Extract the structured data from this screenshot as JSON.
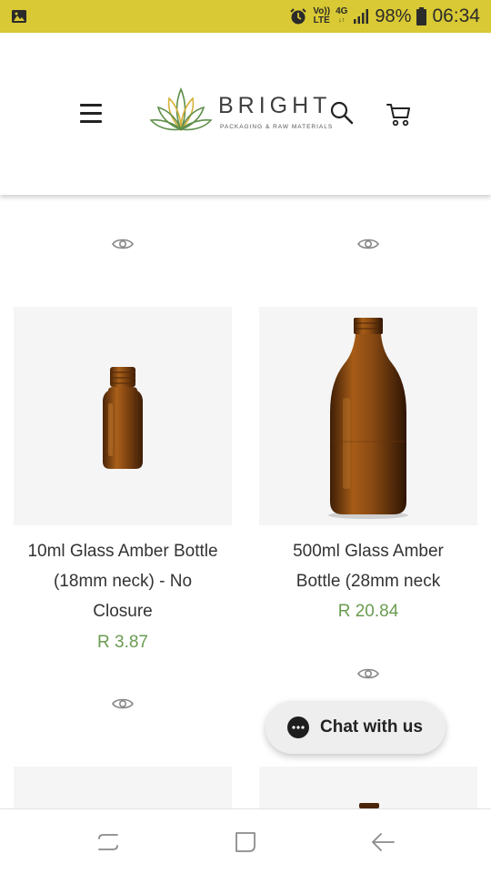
{
  "status_bar": {
    "volte_top": "Vo))",
    "volte_bottom": "LTE",
    "network_top": "4G",
    "network_bottom": "↓↑",
    "battery": "98%",
    "time": "06:34",
    "icons": [
      "gallery-icon",
      "alarm-icon",
      "signal-icon",
      "battery-icon"
    ]
  },
  "header": {
    "logo_word": "BRIGHT",
    "logo_tagline": "PACKAGING & RAW MATERIALS",
    "icons": [
      "menu-icon",
      "search-icon",
      "cart-icon"
    ]
  },
  "products": [
    {
      "title_lines": [
        "10ml Glass Amber Bottle",
        "(18mm neck) - No",
        "Closure"
      ],
      "price": "R 3.87"
    },
    {
      "title_lines": [
        "500ml Glass Amber",
        "Bottle (28mm neck"
      ],
      "price": "R 20.84"
    }
  ],
  "chat": {
    "label": "Chat with us",
    "icon": "chat-bubble-icon"
  },
  "colors": {
    "status_bar": "#d9c934",
    "price": "#6a9c51",
    "amber": "#8a4a12",
    "logo_green": "#5f8f4a",
    "logo_gold": "#d6b23a"
  },
  "nav_icons": [
    "recent-apps-icon",
    "home-icon",
    "back-icon"
  ]
}
